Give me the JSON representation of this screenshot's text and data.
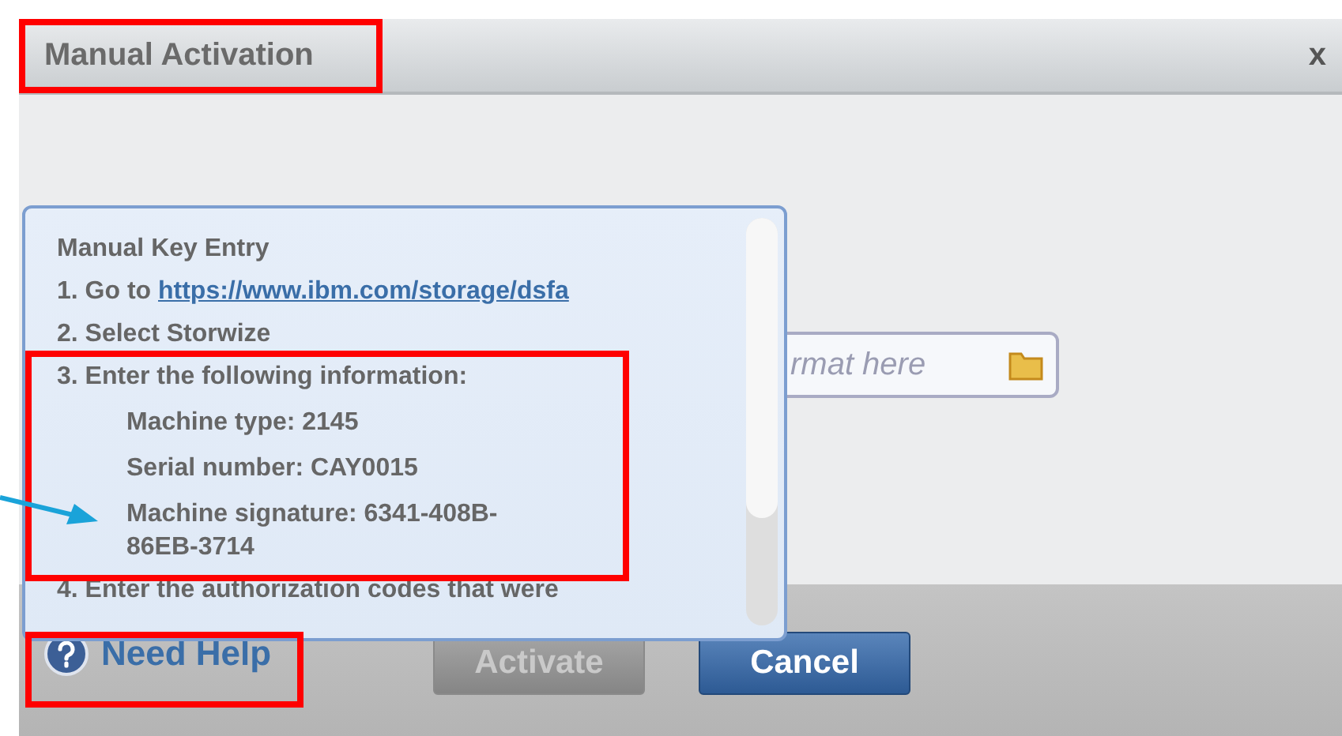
{
  "dialog": {
    "title": "Manual Activation",
    "close_label": "x"
  },
  "file_field": {
    "placeholder": "rmat here"
  },
  "help_popup": {
    "heading": "Manual Key Entry",
    "lines": [
      {
        "kind": "step",
        "text": "1. Go to ",
        "link": "https://www.ibm.com/storage/dsfa"
      },
      {
        "kind": "step",
        "text": "2. Select Storwize"
      },
      {
        "kind": "step",
        "text": "3. Enter the following information:"
      },
      {
        "kind": "detail",
        "text": "Machine type: 2145"
      },
      {
        "kind": "detail",
        "text": "Serial number: CAY0015"
      },
      {
        "kind": "detail",
        "text": "Machine signature: 6341-408B-86EB-3714"
      },
      {
        "kind": "step",
        "text": "4. Enter the authorization codes that were"
      }
    ]
  },
  "footer": {
    "help_link": "Need Help",
    "buttons": [
      {
        "label": "Activate",
        "disabled": true
      },
      {
        "label": "Cancel",
        "disabled": false
      }
    ]
  }
}
